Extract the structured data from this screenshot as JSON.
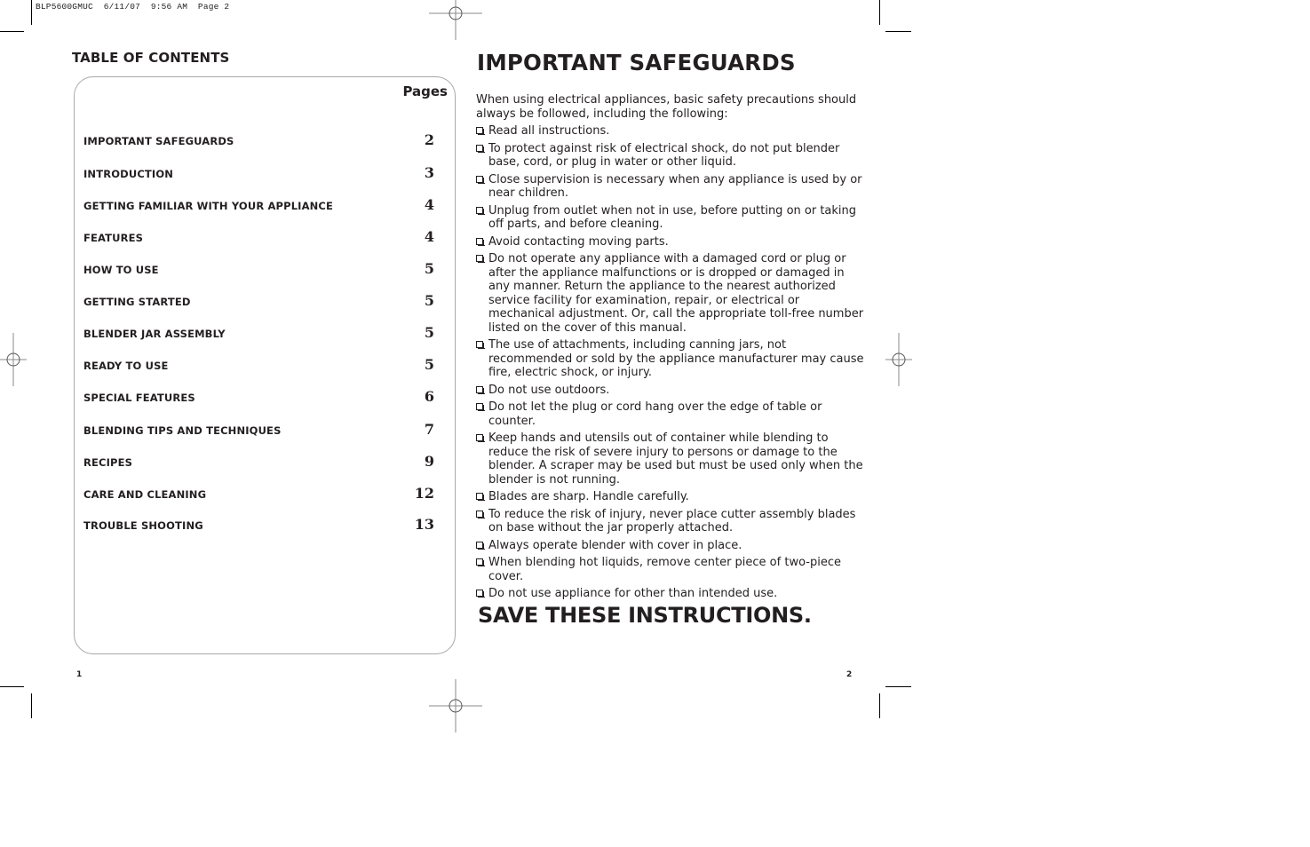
{
  "slug": "BLP5600GMUC  6/11/07  9:56 AM  Page 2",
  "left_page": {
    "title": "TABLE OF CONTENTS",
    "pages_header": "Pages",
    "entries": [
      {
        "label": "IMPORTANT SAFEGUARDS",
        "page": "2"
      },
      {
        "label": "INTRODUCTION",
        "page": "3"
      },
      {
        "label": "GETTING FAMILIAR WITH YOUR APPLIANCE",
        "page": "4"
      },
      {
        "label": "FEATURES",
        "page": "4"
      },
      {
        "label": "HOW TO USE",
        "page": "5"
      },
      {
        "label": "GETTING STARTED",
        "page": "5"
      },
      {
        "label": "BLENDER JAR ASSEMBLY",
        "page": "5"
      },
      {
        "label": "READY TO USE",
        "page": "5"
      },
      {
        "label": "SPECIAL FEATURES",
        "page": "6"
      },
      {
        "label": "BLENDING TIPS AND TECHNIQUES",
        "page": "7"
      },
      {
        "label": "RECIPES",
        "page": "9"
      },
      {
        "label": "CARE AND CLEANING",
        "page": "12"
      },
      {
        "label": "TROUBLE SHOOTING",
        "page": "13"
      }
    ],
    "page_number": "1"
  },
  "right_page": {
    "title": "IMPORTANT SAFEGUARDS",
    "intro": "When using electrical appliances, basic safety precautions should always be followed, including the following:",
    "bullet_icon": "checkbox-icon",
    "items": [
      "Read all instructions.",
      "To protect against risk of electrical shock, do not put blender base, cord, or plug in water or other liquid.",
      "Close supervision is necessary when any appliance is used by or near children.",
      "Unplug from outlet when not in use, before putting on or taking off parts, and before cleaning.",
      "Avoid contacting moving parts.",
      "Do not operate any appliance with a damaged cord or plug or after the appliance malfunctions or is dropped or damaged in any manner. Return the appliance to the nearest authorized service facility for examination, repair, or electrical or mechanical adjustment. Or, call the appropriate toll-free number listed on the cover of this manual.",
      "The use of attachments, including canning jars, not recommended or sold by the appliance manufacturer may cause fire, electric shock, or injury.",
      "Do not use outdoors.",
      "Do not let the plug or cord hang over the edge of table or counter.",
      "Keep hands and utensils out of container while blending to reduce the risk of severe injury to persons or damage to the blender. A scraper may be used but must be used only when the blender is not running.",
      "Blades are sharp. Handle carefully.",
      "To reduce the risk of injury, never place cutter assembly blades on base without the jar properly attached.",
      "Always operate blender with cover in place.",
      "When blending hot liquids, remove center piece of two-piece cover.",
      "Do not use appliance for other than intended use."
    ],
    "closing": "SAVE THESE INSTRUCTIONS.",
    "page_number": "2"
  }
}
